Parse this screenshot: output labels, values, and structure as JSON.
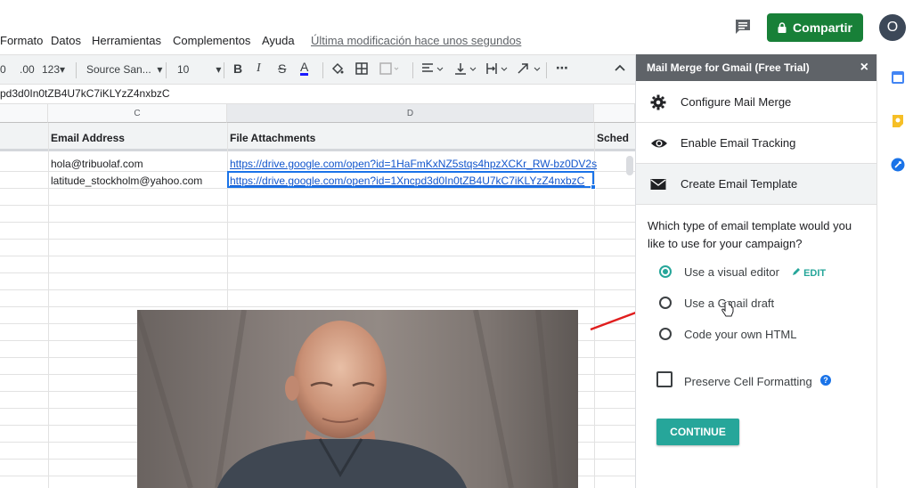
{
  "menu": {
    "items": [
      "Formato",
      "Datos",
      "Herramientas",
      "Complementos",
      "Ayuda"
    ],
    "last_modified": "Última modificación hace unos segundos"
  },
  "header": {
    "share_label": "Compartir",
    "avatar_initial": "O"
  },
  "toolbar": {
    "decimal_less": "0",
    "decimal_more": ".00",
    "number_format": "123",
    "font_family": "Source San...",
    "font_size": "10",
    "bold": "B",
    "italic": "I",
    "strike": "S",
    "text_color": "A"
  },
  "formula_bar": {
    "value": "pd3d0In0tZB4U7kC7iKLYzZ4nxbzC"
  },
  "grid": {
    "columns": [
      "C",
      "D"
    ],
    "headers": [
      "Email Address",
      "File Attachments",
      "Sched"
    ],
    "rows": [
      {
        "email": "hola@tribuolaf.com",
        "attachment": "https://drive.google.com/open?id=1HaFmKxNZ5stqs4hpzXCKr_RW-bz0DV2s"
      },
      {
        "email": "latitude_stockholm@yahoo.com",
        "attachment": "https://drive.google.com/open?id=1Xncpd3d0In0tZB4U7kC7iKLYzZ4nxbzC"
      }
    ]
  },
  "panel": {
    "title": "Mail Merge for Gmail (Free Trial)",
    "close": "×",
    "items": [
      {
        "label": "Configure Mail Merge",
        "icon": "gear-icon"
      },
      {
        "label": "Enable Email Tracking",
        "icon": "eye-icon"
      },
      {
        "label": "Create Email Template",
        "icon": "envelope-icon"
      }
    ],
    "question": "Which type of email template would you like to use for your campaign?",
    "options": [
      {
        "label": "Use a visual editor",
        "selected": true
      },
      {
        "label": "Use a Gmail draft",
        "selected": false
      },
      {
        "label": "Code your own HTML",
        "selected": false
      }
    ],
    "edit_label": "EDIT",
    "preserve_label": "Preserve Cell Formatting",
    "help": "?",
    "continue_label": "CONTINUE"
  },
  "colors": {
    "share_green": "#188038",
    "accent_teal": "#26a69a",
    "link_blue": "#1155cc",
    "panel_header": "#5f6368"
  }
}
